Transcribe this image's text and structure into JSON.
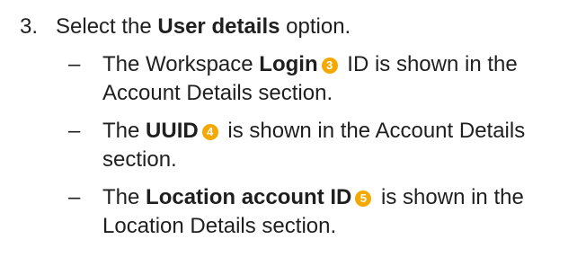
{
  "step": {
    "number": "3.",
    "text_before": "Select the ",
    "bold": "User details",
    "text_after": " option."
  },
  "bullets": [
    {
      "dash": "–",
      "before": "The Workspace ",
      "bold": "Login",
      "callout": "3",
      "after": " ID is shown in the Account Details section."
    },
    {
      "dash": "–",
      "before": "The ",
      "bold": "UUID",
      "callout": "4",
      "after": " is shown in the Account Details section."
    },
    {
      "dash": "–",
      "before": "The ",
      "bold": "Location account ID",
      "callout": "5",
      "after": " is shown in the Location Details section."
    }
  ],
  "colors": {
    "callout": "#f5a800",
    "text": "#1f1f1f"
  }
}
